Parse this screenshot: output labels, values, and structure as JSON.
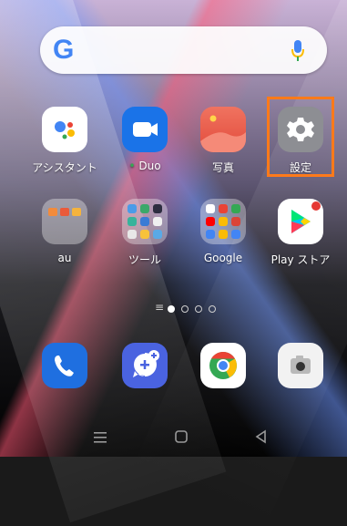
{
  "search": {
    "logo_letter": "G"
  },
  "apps_row1": [
    {
      "name": "アシスタント"
    },
    {
      "name": "Duo",
      "dot": "•"
    },
    {
      "name": "写真"
    },
    {
      "name": "設定"
    }
  ],
  "apps_row2": [
    {
      "name": "au"
    },
    {
      "name": "ツール"
    },
    {
      "name": "Google"
    },
    {
      "name": "Play ストア"
    }
  ],
  "dock": [
    {
      "icon": "phone-icon"
    },
    {
      "icon": "messages-icon"
    },
    {
      "icon": "chrome-icon"
    },
    {
      "icon": "camera-icon"
    }
  ],
  "page_indicator": {
    "menu_glyph": "≡",
    "pages": 4,
    "active_page": 1
  },
  "colors": {
    "highlight": "#ff7a1a",
    "settings_tile": "#8d8e93",
    "duo_dot": "#34a853"
  }
}
